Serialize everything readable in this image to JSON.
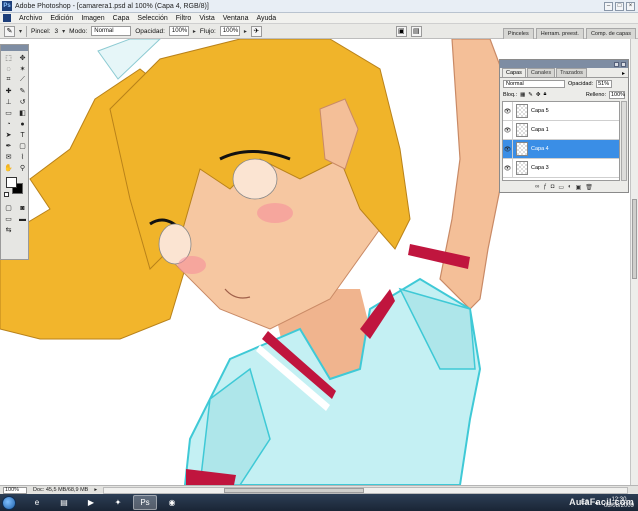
{
  "window": {
    "title": "Adobe Photoshop - [camarera1.psd al 100% (Capa 4, RGB/8)]"
  },
  "menu": [
    "Archivo",
    "Edición",
    "Imagen",
    "Capa",
    "Selección",
    "Filtro",
    "Vista",
    "Ventana",
    "Ayuda"
  ],
  "options": {
    "brush_label": "Pincel:",
    "brush_size": "3",
    "mode_label": "Modo:",
    "mode_value": "Normal",
    "opacity_label": "Opacidad:",
    "opacity_value": "100%",
    "flow_label": "Flujo:",
    "flow_value": "100%"
  },
  "docked_tabs": [
    "Pinceles",
    "Herram. preest.",
    "Comp. de capas"
  ],
  "layers_panel": {
    "tabs": [
      "Capas",
      "Canales",
      "Trazados"
    ],
    "blend_mode": "Normal",
    "opacity_label": "Opacidad:",
    "opacity_value": "51%",
    "lock_label": "Bloq.:",
    "fill_label": "Relleno:",
    "fill_value": "100%",
    "layers": [
      {
        "name": "Capa 5",
        "selected": false
      },
      {
        "name": "Capa 1",
        "selected": false
      },
      {
        "name": "Capa 4",
        "selected": true
      },
      {
        "name": "Capa 3",
        "selected": false
      }
    ]
  },
  "status": {
    "zoom": "100%",
    "doc": "Doc: 45,5 MB/68,9 MB"
  },
  "taskbar": {
    "language": "ES",
    "time": "12:30",
    "date": "08/08/2009"
  },
  "watermark": "AulaFacil.com",
  "colors": {
    "selection_blue": "#3a8ee6",
    "hair": "#f0b42a",
    "skin": "#f6c7a1",
    "shirt": "#bdeef2",
    "collar_red": "#c0153e"
  }
}
